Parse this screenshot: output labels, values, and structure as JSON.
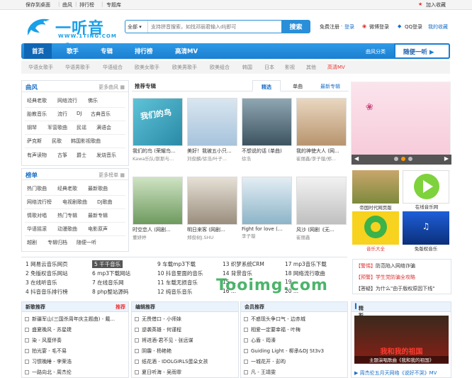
{
  "topbar": {
    "links": [
      "保存到桌面",
      "曲风",
      "排行榜",
      "专题库"
    ],
    "favorite": "加入收藏"
  },
  "logo": {
    "name": "一听音乐",
    "domain": "WWW.1TING.COM"
  },
  "search": {
    "category": "全部",
    "placeholder": "支持拼音搜索，如找邓丽君输入dlj即可",
    "button": "搜索"
  },
  "login": {
    "free": "免费注册",
    "sep": "·",
    "login": "登录",
    "weibo": "微博登录",
    "qq": "QQ登录",
    "reward": "我的收藏"
  },
  "nav": {
    "items": [
      "首页",
      "歌手",
      "专辑",
      "排行榜",
      "高清MV"
    ],
    "genre": "曲风分类",
    "random": "随便一听"
  },
  "subnav": [
    "华语女歌手",
    "华语男歌手",
    "华语组合",
    "欧美女歌手",
    "欧美男歌手",
    "欧美组合",
    "韩国",
    "日本",
    "影视",
    "其他",
    "高清MV"
  ],
  "genre_panel": {
    "title": "曲风",
    "more": "更多曲风",
    "rows": [
      [
        "经典老歌",
        "网络流行",
        "佛乐"
      ],
      [
        "胎教音乐",
        "流行",
        "DJ",
        "古典音乐"
      ],
      [
        "钢琴",
        "军营歌曲",
        "民谣",
        "满语会"
      ],
      [
        "萨克斯",
        "民歌",
        "韩国影视歌曲"
      ],
      [
        "有声读物",
        "古筝",
        "爵士",
        "发烧音乐"
      ]
    ]
  },
  "chart_panel": {
    "title": "榜单",
    "more": "更多榜单",
    "rows": [
      [
        "热门歌曲",
        "经典老歌",
        "最新歌曲"
      ],
      [
        "网络流行榜",
        "电视剧歌曲",
        "DJ歌曲"
      ],
      [
        "情歌对唱",
        "热门专辑",
        "最新专辑"
      ],
      [
        "华语摇滚",
        "动漫歌曲",
        "电影原声"
      ],
      [
        "越剧",
        "专辑归档",
        "随便一听"
      ]
    ]
  },
  "album_section": {
    "title": "推荐专辑",
    "tabs": [
      "精选",
      "单曲",
      "最新专辑"
    ],
    "albums": [
      {
        "title": "我们的鸟 (荣耀鸟...",
        "artist": "Kawa乐队/斯斯与..."
      },
      {
        "title": "美好！我被五小只...",
        "artist": "刘俊麟/徐浩/叶子..."
      },
      {
        "title": "不想说的话 (单曲)",
        "artist": "徐浩"
      },
      {
        "title": "我的神使大人 (网...",
        "artist": "崔丽鑫/李子璇/郑..."
      },
      {
        "title": "时空恋人 (网剧...",
        "artist": "董妍婷"
      },
      {
        "title": "明日来客 (网剧...",
        "artist": "郑俊树J.SHU"
      },
      {
        "title": "Fight for love (...",
        "artist": "李子璇"
      },
      {
        "title": "风沙 (网剧《无...",
        "artist": "崔丽鑫"
      }
    ]
  },
  "apps": [
    {
      "label": "帝国时代网页版"
    },
    {
      "label": "在线音乐网"
    },
    {
      "label": "音乐大全"
    },
    {
      "label": "免版权音乐"
    }
  ],
  "rank_list": [
    [
      "1 网易云音乐网页",
      "5 千千音乐",
      "9 车载mp3下载",
      "13 织梦系统CRM",
      "17 mp3音乐下载"
    ],
    [
      "2 免版权音乐网站",
      "6 mp3下载网站",
      "10 抖音里面的音乐",
      "14 背景音乐",
      "18 网络流行歌曲"
    ],
    [
      "3 在线听音乐",
      "7 在线音乐网",
      "11 车载无损音乐",
      "15 ...",
      "19 ..."
    ],
    [
      "4 抖音音乐排行榜",
      "8 php整站源码",
      "12 纯音乐音乐",
      "16 ...",
      "20 ..."
    ]
  ],
  "notices": [
    {
      "tag": "【警惕】",
      "text": "防范陷入网络诈骗"
    },
    {
      "tag": "【预警】",
      "text": "学生党防骗全攻略"
    },
    {
      "tag": "【答疑】",
      "text": "为什么\"由于版权原因下线\""
    }
  ],
  "watermark": "Tooimg.com",
  "new_songs": {
    "title": "新歌推荐",
    "badge": "推荐",
    "items": [
      "新疆军山(三国杀周年庆主题曲) - 戴...",
      "盛夏晚风 - 苏星婕",
      "染 - 风厘伴奏",
      "拍光宴 - 毛不易",
      "习惯晚睡 - 李荣浩",
      "一路向北 - 周杰伦"
    ]
  },
  "editor_songs": {
    "title": "编辑推荐",
    "items": [
      "无畏借口 - 小师妹",
      "逆袭英雄 - 何谨程",
      "将进酒-君不见 - 张远谋",
      "阴霾 - 杨艳艳",
      "纸花酒 - IDOLGIRLS蛋朵女孩",
      "夏日听海 - 吴雨霏"
    ]
  },
  "member_songs": {
    "title": "会员推荐",
    "items": [
      "不惑现头争口气 - 边赤城",
      "相爱一定要幸福 - 叶梅",
      "心盾 - 筠溱",
      "Guiding Light - 柳承&DJ St3v3",
      "一城花开 - 彭昀",
      "凡 - 王靖雯"
    ]
  },
  "mv": {
    "title": "精彩MV推荐",
    "caption": "主题演唱歌曲《我和我的祖国》",
    "poster_text": "我和我的祖国",
    "footer": "周杰伦五月天网络《说好不哭》MV"
  }
}
